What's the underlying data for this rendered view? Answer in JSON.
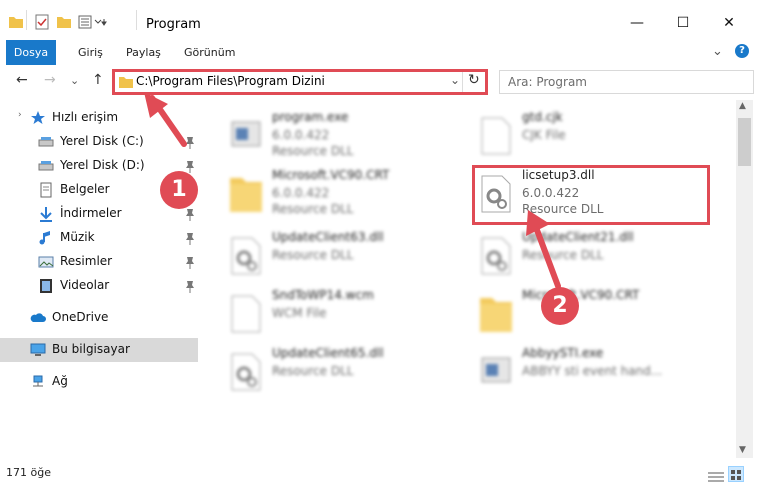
{
  "window": {
    "title": "Program",
    "minimize": "—",
    "maximize": "☐",
    "close": "✕"
  },
  "ribbon": {
    "tabs": [
      "Dosya",
      "Giriş",
      "Paylaş",
      "Görünüm"
    ],
    "collapse": "⌄",
    "help": "?"
  },
  "address": {
    "path": "C:\\Program Files\\Program Dizini",
    "refresh": "↻",
    "dropdown": "⌄"
  },
  "search": {
    "placeholder": "Ara: Program",
    "icon": "⌕"
  },
  "nav": {
    "back": "←",
    "forward": "→",
    "recent": "⌄",
    "up": "↑"
  },
  "sidebar": {
    "items": [
      {
        "label": "Hızlı erişim",
        "icon": "star-icon",
        "pinned": false
      },
      {
        "label": "Yerel Disk (C:)",
        "icon": "drive-icon",
        "pinned": true
      },
      {
        "label": "Yerel Disk (D:)",
        "icon": "drive-icon",
        "pinned": true
      },
      {
        "label": "Belgeler",
        "icon": "documents-icon",
        "pinned": true
      },
      {
        "label": "İndirmeler",
        "icon": "download-icon",
        "pinned": true
      },
      {
        "label": "Müzik",
        "icon": "music-icon",
        "pinned": true
      },
      {
        "label": "Resimler",
        "icon": "pictures-icon",
        "pinned": true
      },
      {
        "label": "Videolar",
        "icon": "video-icon",
        "pinned": true
      },
      {
        "label": "OneDrive",
        "icon": "cloud-icon",
        "pinned": false
      },
      {
        "label": "Bu bilgisayar",
        "icon": "computer-icon",
        "pinned": false
      },
      {
        "label": "Ağ",
        "icon": "network-icon",
        "pinned": false
      }
    ],
    "pin_glyph": "📌"
  },
  "files": {
    "left": [
      {
        "name": "program.exe",
        "line2": "6.0.0.422",
        "line3": "Resource DLL",
        "icon": "exe-icon"
      },
      {
        "name": "Microsoft.VC90.CRT",
        "line2": "6.0.0.422",
        "line3": "Resource DLL",
        "icon": "folder-icon"
      },
      {
        "name": "UpdateClient63.dll",
        "line2": "Resource DLL",
        "line3": "",
        "icon": "dll-icon"
      },
      {
        "name": "SndToWP14.wcm",
        "line2": "WCM File",
        "line3": "",
        "icon": "file-icon"
      },
      {
        "name": "UpdateClient65.dll",
        "line2": "Resource DLL",
        "line3": "",
        "icon": "dll-icon"
      }
    ],
    "right": [
      {
        "name": "gtd.cjk",
        "line2": "CJK File",
        "line3": "",
        "icon": "file-icon"
      },
      {
        "name": "licsetup3.dll",
        "line2": "6.0.0.422",
        "line3": "Resource DLL",
        "icon": "dll-icon"
      },
      {
        "name": "UpdateClient21.dll",
        "line2": "Resource DLL",
        "line3": "",
        "icon": "dll-icon"
      },
      {
        "name": "Microsoft.VC90.CRT",
        "line2": "",
        "line3": "",
        "icon": "folder-icon"
      },
      {
        "name": "AbbyySTI.exe",
        "line2": "ABBYY sti event hand...",
        "line3": "",
        "icon": "exe-icon"
      }
    ]
  },
  "status": {
    "count": "171 öğe"
  },
  "callouts": [
    "1",
    "2"
  ],
  "colors": {
    "accent": "#1979ca",
    "highlight": "#e04b55",
    "selected": "#cce8ff"
  }
}
